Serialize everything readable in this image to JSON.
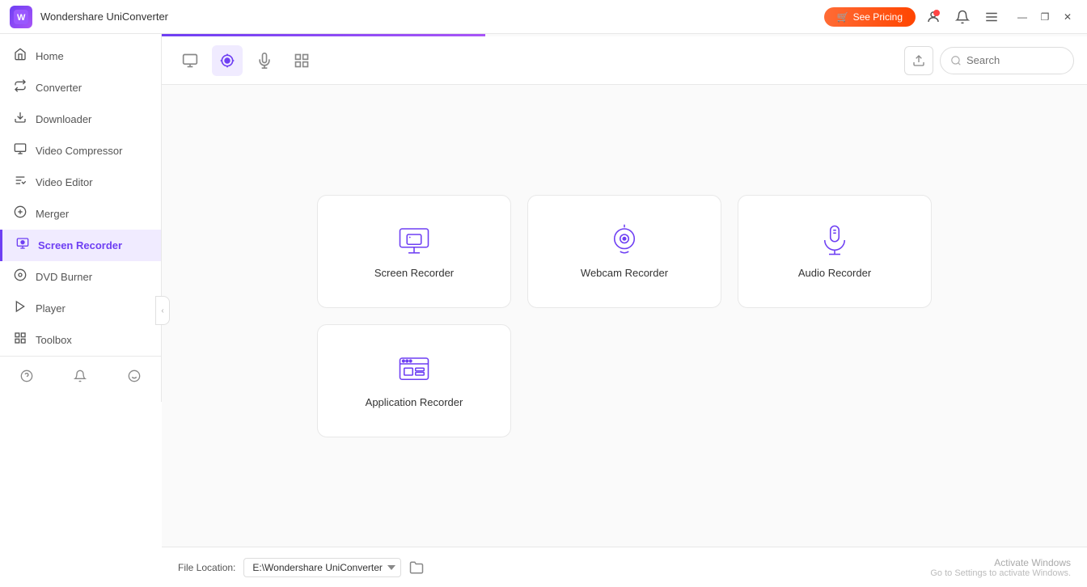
{
  "app": {
    "title": "Wondershare UniConverter",
    "logo_initial": "W"
  },
  "title_bar": {
    "see_pricing": "See Pricing",
    "minimize": "—",
    "restore": "❐",
    "close": "✕"
  },
  "sidebar": {
    "items": [
      {
        "id": "home",
        "label": "Home",
        "icon": "⌂"
      },
      {
        "id": "converter",
        "label": "Converter",
        "icon": "⇄"
      },
      {
        "id": "downloader",
        "label": "Downloader",
        "icon": "↓"
      },
      {
        "id": "video-compressor",
        "label": "Video Compressor",
        "icon": "▣"
      },
      {
        "id": "video-editor",
        "label": "Video Editor",
        "icon": "✂"
      },
      {
        "id": "merger",
        "label": "Merger",
        "icon": "⊕"
      },
      {
        "id": "screen-recorder",
        "label": "Screen Recorder",
        "icon": "⬛",
        "active": true
      },
      {
        "id": "dvd-burner",
        "label": "DVD Burner",
        "icon": "◉"
      },
      {
        "id": "player",
        "label": "Player",
        "icon": "▷"
      },
      {
        "id": "toolbox",
        "label": "Toolbox",
        "icon": "⊞"
      }
    ],
    "bottom_icons": [
      {
        "id": "help",
        "icon": "?"
      },
      {
        "id": "notifications",
        "icon": "🔔"
      },
      {
        "id": "feedback",
        "icon": "☺"
      }
    ]
  },
  "top_bar": {
    "tabs": [
      {
        "id": "screen",
        "icon": "▣",
        "active": false
      },
      {
        "id": "webcam",
        "icon": "◉",
        "active": true
      },
      {
        "id": "audio",
        "icon": "⊕",
        "active": false
      },
      {
        "id": "grid",
        "icon": "⊞",
        "active": false
      }
    ],
    "search_placeholder": "Search"
  },
  "recorders": [
    {
      "id": "screen-recorder",
      "label": "Screen Recorder",
      "icon": "screen"
    },
    {
      "id": "webcam-recorder",
      "label": "Webcam Recorder",
      "icon": "webcam"
    },
    {
      "id": "audio-recorder",
      "label": "Audio Recorder",
      "icon": "audio"
    },
    {
      "id": "application-recorder",
      "label": "Application Recorder",
      "icon": "application"
    }
  ],
  "bottom_bar": {
    "file_location_label": "File Location:",
    "file_location_value": "E:\\Wondershare UniConverter",
    "activate_title": "Activate Windows",
    "activate_sub": "Go to Settings to activate Windows."
  }
}
